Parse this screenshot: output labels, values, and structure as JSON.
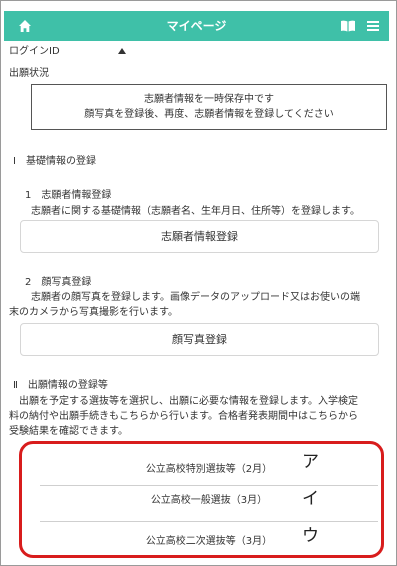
{
  "header": {
    "title": "マイページ",
    "icons": [
      "home-icon",
      "book-icon",
      "menu-icon"
    ],
    "color": "#3fc0a8"
  },
  "login_id_label": "ログインID",
  "application_status_label": "出願状況",
  "notice": {
    "line1": "志願者情報を一時保存中です",
    "line2": "顔写真を登録後、再度、志願者情報を登録してください"
  },
  "section1": {
    "heading": "Ⅰ　基礎情報の登録",
    "step1": {
      "title": "1　志願者情報登録",
      "desc": "志願者に関する基礎情報（志願者名、生年月日、住所等）を登録します。",
      "button": "志願者情報登録"
    },
    "step2": {
      "title": "2　顔写真登録",
      "desc_line1": "志願者の顔写真を登録します。画像データのアップロード又はお使いの端",
      "desc_line2": "末のカメラから写真撮影を行います。",
      "button": "顔写真登録"
    }
  },
  "section2": {
    "heading": "Ⅱ　出願情報の登録等",
    "desc_line1": "出願を予定する選抜等を選択し、出願に必要な情報を登録します。入学検定",
    "desc_line2": "料の納付や出願手続きもこちらから行います。合格者発表期間中はこちらから",
    "desc_line3": "受験結果を確認できます。",
    "options": [
      {
        "label": "公立高校特別選抜等（2月）",
        "mark": "ア"
      },
      {
        "label": "公立高校一般選抜（3月）",
        "mark": "イ"
      },
      {
        "label": "公立高校二次選抜等（3月）",
        "mark": "ウ"
      }
    ],
    "highlight_color": "#d81c1c"
  }
}
